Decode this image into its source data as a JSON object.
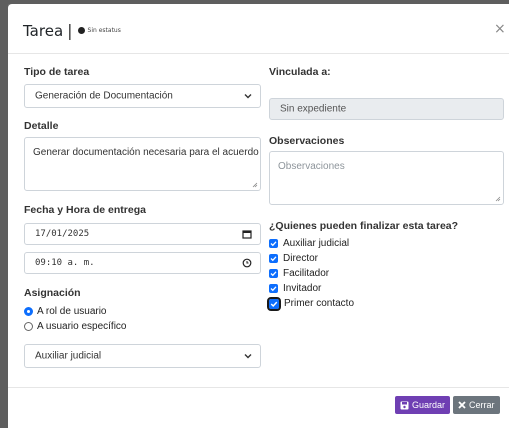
{
  "modal": {
    "title": "Tarea",
    "separator": "|",
    "status": "Sin estatus",
    "close_symbol": "×"
  },
  "left": {
    "tipo_label": "Tipo de tarea",
    "tipo_value": "Generación de Documentación",
    "detalle_label": "Detalle",
    "detalle_value": "Generar documentación necesaria para el acuerdo",
    "fecha_label": "Fecha y Hora de entrega",
    "date_value": "17/01/2025",
    "time_value": "09:10 a. m.",
    "asignacion_label": "Asignación",
    "radio_rol": "A rol de usuario",
    "radio_usuario": "A usuario específico",
    "rol_value": "Auxiliar judicial"
  },
  "right": {
    "vinculada_label": "Vinculada a:",
    "expediente_value": "Sin expediente",
    "observaciones_label": "Observaciones",
    "observaciones_placeholder": "Observaciones",
    "finalizar_label": "¿Quienes pueden finalizar esta tarea?",
    "roles": [
      "Auxiliar judicial",
      "Director",
      "Facilitador",
      "Invitador",
      "Primer contacto"
    ]
  },
  "footer": {
    "save_label": "Guardar",
    "close_label": "Cerrar"
  },
  "colors": {
    "primary": "#6f3fb3",
    "secondary": "#6c757d",
    "check": "#0d6efd"
  }
}
